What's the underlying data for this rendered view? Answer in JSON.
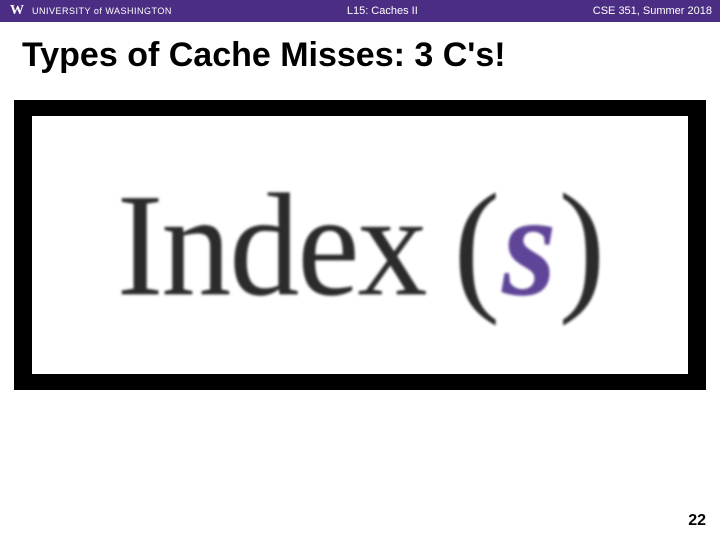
{
  "header": {
    "university_logo_letter": "W",
    "university_name": "UNIVERSITY of WASHINGTON",
    "lecture": "L15: Caches II",
    "course": "CSE 351, Summer 2018"
  },
  "title": "Types of Cache Misses: 3 C's!",
  "overlay": {
    "word": "Index",
    "lparen": "(",
    "variable": "s",
    "rparen": ")"
  },
  "page_number": "22"
}
